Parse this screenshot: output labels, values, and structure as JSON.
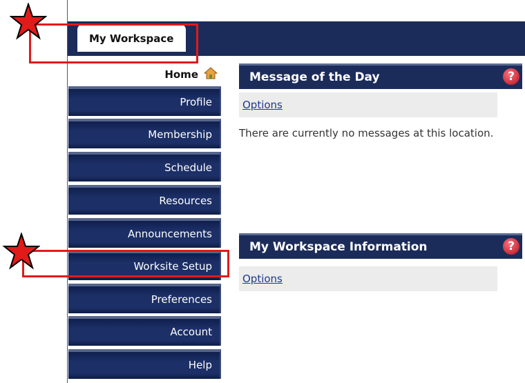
{
  "workspace_tab": {
    "label": "My Workspace"
  },
  "sidebar": {
    "home_label": "Home",
    "items": [
      {
        "label": "Profile"
      },
      {
        "label": "Membership"
      },
      {
        "label": "Schedule"
      },
      {
        "label": "Resources"
      },
      {
        "label": "Announcements"
      },
      {
        "label": "Worksite Setup"
      },
      {
        "label": "Preferences"
      },
      {
        "label": "Account"
      },
      {
        "label": "Help"
      }
    ]
  },
  "panes": {
    "motd": {
      "title": "Message of the Day",
      "options_label": "Options",
      "message": "There are currently no messages at this location."
    },
    "info": {
      "title": "My Workspace Information",
      "options_label": "Options"
    }
  },
  "help_icon_glyph": "?",
  "colors": {
    "nav_blue": "#1c2c5a",
    "annotation_red": "#e11a1a"
  }
}
